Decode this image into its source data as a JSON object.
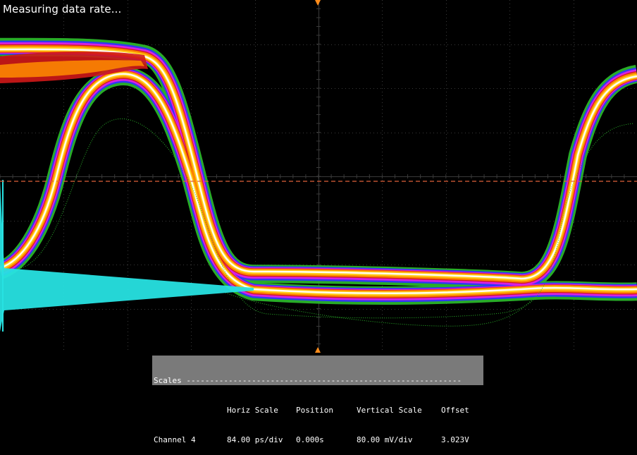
{
  "status": {
    "message": "Measuring data rate..."
  },
  "colors": {
    "background": "#000000",
    "grid": "#3a3a3a",
    "trigger_level": "#e0603a",
    "marker": "#ff8c1a",
    "channel_trace": "#27e2e2",
    "persistence": [
      "#2ab52a",
      "#3030ff",
      "#e020e0",
      "#d01818",
      "#ff8c00",
      "#ffd21a",
      "#ffffff"
    ]
  },
  "display": {
    "mode": "eye-diagram-color-persistence",
    "grid": {
      "h_divisions": 10,
      "v_divisions": 8
    }
  },
  "scales_panel": {
    "title": "Scales ",
    "dashes": "-----------------------------------------------------------",
    "headers": {
      "horiz_scale": "Horiz Scale",
      "position": "Position",
      "vertical_scale": "Vertical Scale",
      "offset": "Offset"
    },
    "channel": {
      "name": "Channel 4",
      "horiz_scale": "84.00 ps/div",
      "position": "0.000s",
      "vertical_scale": "80.00 mV/div",
      "offset": "3.023V"
    }
  }
}
